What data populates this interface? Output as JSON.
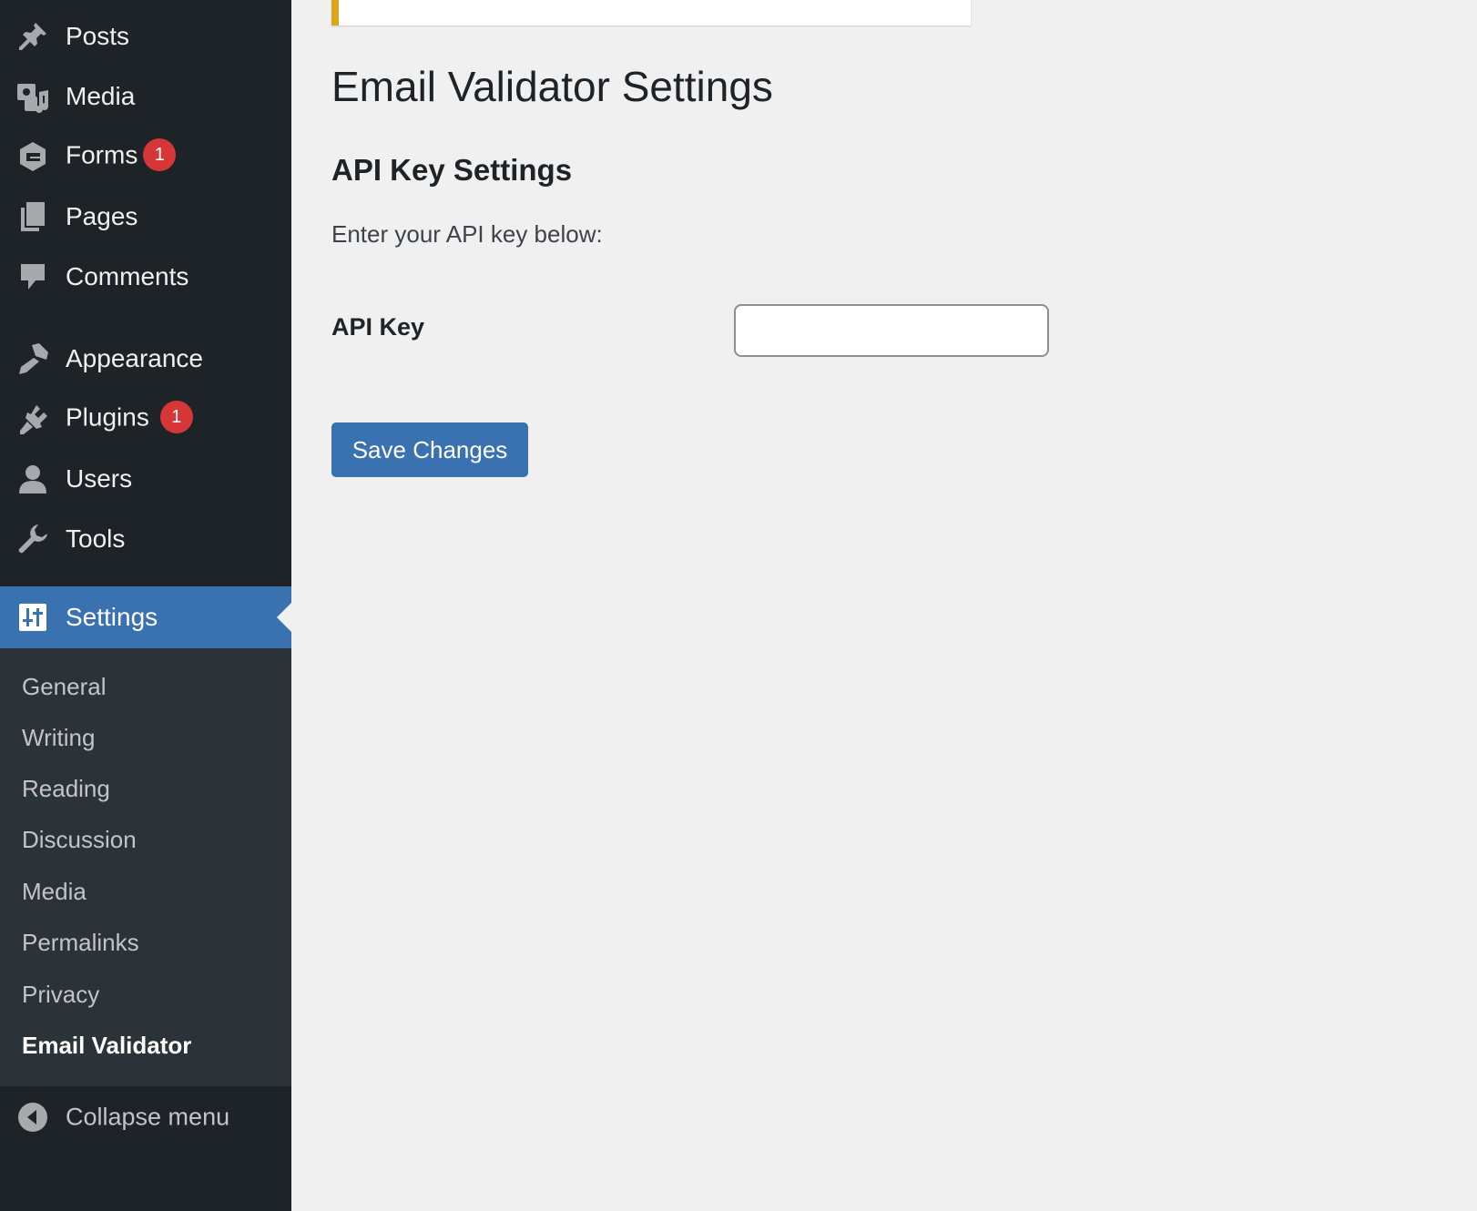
{
  "sidebar": {
    "menu": [
      {
        "label": "Posts",
        "icon": "pin-icon"
      },
      {
        "label": "Media",
        "icon": "media-icon"
      },
      {
        "label": "Forms",
        "icon": "forms-icon",
        "badge": "1"
      },
      {
        "label": "Pages",
        "icon": "pages-icon"
      },
      {
        "label": "Comments",
        "icon": "comment-icon"
      },
      {
        "label": "Appearance",
        "icon": "brush-icon"
      },
      {
        "label": "Plugins",
        "icon": "plug-icon",
        "badge": "1"
      },
      {
        "label": "Users",
        "icon": "user-icon"
      },
      {
        "label": "Tools",
        "icon": "wrench-icon"
      },
      {
        "label": "Settings",
        "icon": "sliders-icon",
        "active": true
      }
    ],
    "submenu": [
      {
        "label": "General"
      },
      {
        "label": "Writing"
      },
      {
        "label": "Reading"
      },
      {
        "label": "Discussion"
      },
      {
        "label": "Media"
      },
      {
        "label": "Permalinks"
      },
      {
        "label": "Privacy"
      },
      {
        "label": "Email Validator",
        "current": true
      }
    ],
    "collapse_label": "Collapse menu"
  },
  "main": {
    "page_title": "Email Validator Settings",
    "section_title": "API Key Settings",
    "section_description": "Enter your API key below:",
    "api_key_label": "API Key",
    "api_key_value": "",
    "save_button": "Save Changes"
  },
  "colors": {
    "sidebar_bg": "#1d2327",
    "submenu_bg": "#2c3338",
    "accent": "#3a71b1",
    "badge": "#d63638",
    "notice_border": "#dba617",
    "page_bg": "#f0f0f1"
  }
}
